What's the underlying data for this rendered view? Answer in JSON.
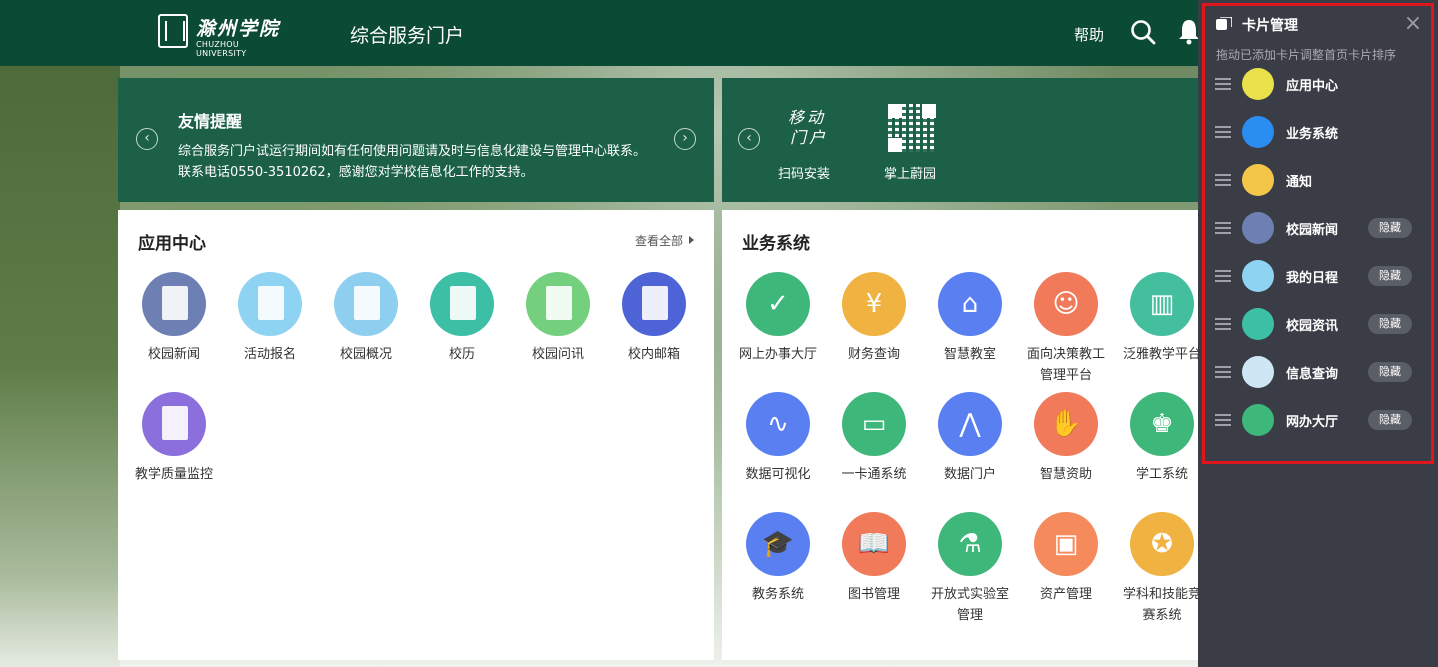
{
  "header": {
    "logo_cn": "滁州学院",
    "logo_en": "CHUZHOU UNIVERSITY",
    "portal_title": "综合服务门户",
    "help_label": "帮助",
    "search_icon": "search-icon",
    "bell_icon": "bell-icon"
  },
  "notice": {
    "title": "友情提醒",
    "line1": "综合服务门户试运行期间如有任何使用问题请及时与信息化建设与管理中心联系。",
    "line2": "联系电话0550-3510262，感谢您对学校信息化工作的支持。",
    "prev": "‹",
    "next": "›"
  },
  "mobile": {
    "logo_line1": "移动",
    "logo_line2": "门户",
    "scan_label": "扫码安装",
    "app_label": "掌上蔚园",
    "prev": "‹"
  },
  "app_center": {
    "title": "应用中心",
    "more": "查看全部",
    "tiles": [
      {
        "label": "校园新闻",
        "color": "#6d7fb3",
        "icon": "news-icon"
      },
      {
        "label": "活动报名",
        "color": "#8fd3f2",
        "icon": "signup-icon"
      },
      {
        "label": "校园概况",
        "color": "#8ecff0",
        "icon": "campus-icon"
      },
      {
        "label": "校历",
        "color": "#3cbfa5",
        "icon": "calendar-icon"
      },
      {
        "label": "校园问讯",
        "color": "#74d07f",
        "icon": "inquiry-icon"
      },
      {
        "label": "校内邮箱",
        "color": "#4e64d6",
        "icon": "mail-icon"
      },
      {
        "label": "教学质量监控",
        "color": "#8b6fdc",
        "icon": "presentation-icon"
      }
    ]
  },
  "biz": {
    "title": "业务系统",
    "tiles": [
      {
        "label": "网上办事大厅",
        "color": "#3db87a",
        "icon": "check-icon",
        "glyph": "✓"
      },
      {
        "label": "财务查询",
        "color": "#f0b240",
        "icon": "finance-icon",
        "glyph": "¥"
      },
      {
        "label": "智慧教室",
        "color": "#5a7ff0",
        "icon": "door-icon",
        "glyph": "⌂"
      },
      {
        "label": "面向决策教工管理平台",
        "color": "#f07a5a",
        "icon": "staff-icon",
        "glyph": "☺"
      },
      {
        "label": "泛雅教学平台",
        "color": "#44bf9e",
        "icon": "book-open-icon",
        "glyph": "▥"
      },
      {
        "label": "数据可视化",
        "color": "#5a7ff0",
        "icon": "monitor-icon",
        "glyph": "∿"
      },
      {
        "label": "一卡通系统",
        "color": "#3db87a",
        "icon": "card-icon",
        "glyph": "▭"
      },
      {
        "label": "数据门户",
        "color": "#5a7ff0",
        "icon": "chart-screen-icon",
        "glyph": "⋀"
      },
      {
        "label": "智慧资助",
        "color": "#f07a5a",
        "icon": "hand-icon",
        "glyph": "✋"
      },
      {
        "label": "学工系统",
        "color": "#3db87a",
        "icon": "graduate-icon",
        "glyph": "♚"
      },
      {
        "label": "教务系统",
        "color": "#5a7ff0",
        "icon": "mortarboard-icon",
        "glyph": "🎓"
      },
      {
        "label": "图书管理",
        "color": "#f07a5a",
        "icon": "library-icon",
        "glyph": "📖"
      },
      {
        "label": "开放式实验室管理",
        "color": "#3db87a",
        "icon": "flask-icon",
        "glyph": "⚗"
      },
      {
        "label": "资产管理",
        "color": "#f58a5c",
        "icon": "asset-icon",
        "glyph": "▣"
      },
      {
        "label": "学科和技能竞赛系统",
        "color": "#f0b240",
        "icon": "medal-icon",
        "glyph": "✪"
      }
    ]
  },
  "panel": {
    "title": "卡片管理",
    "subtitle": "拖动已添加卡片调整首页卡片排序",
    "close": "×",
    "items": [
      {
        "label": "应用中心",
        "hidden_label": "",
        "icon": "cube-icon",
        "color": "#e9e14a"
      },
      {
        "label": "业务系统",
        "hidden_label": "",
        "icon": "system-icon",
        "color": "#2a8ef0"
      },
      {
        "label": "通知",
        "hidden_label": "",
        "icon": "bell-icon",
        "color": "#f3c64a"
      },
      {
        "label": "校园新闻",
        "hidden_label": "隐藏",
        "icon": "news-icon",
        "color": "#6d7fb3"
      },
      {
        "label": "我的日程",
        "hidden_label": "隐藏",
        "icon": "schedule-icon",
        "color": "#8fd3f2"
      },
      {
        "label": "校园资讯",
        "hidden_label": "隐藏",
        "icon": "info-icon",
        "color": "#3cbfa5"
      },
      {
        "label": "信息查询",
        "hidden_label": "隐藏",
        "icon": "query-icon",
        "color": "#cfe6f5"
      },
      {
        "label": "网办大厅",
        "hidden_label": "隐藏",
        "icon": "check-icon",
        "color": "#3db87a"
      }
    ]
  }
}
